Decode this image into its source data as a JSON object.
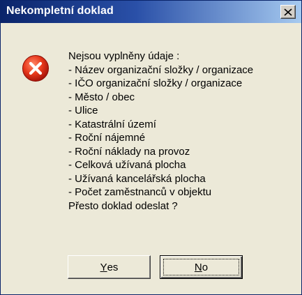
{
  "window": {
    "title": "Nekompletní doklad"
  },
  "icons": {
    "error": "error-icon",
    "close": "close-icon"
  },
  "message": {
    "intro": "Nejsou vyplněny údaje :",
    "items": [
      "- Název organizační složky / organizace",
      "- IČO organizační složky / organizace",
      "- Město / obec",
      "- Ulice",
      "- Katastrální území",
      "- Roční nájemné",
      "- Roční náklady na provoz",
      "- Celková užívaná plocha",
      "- Užívaná kancelářská plocha",
      "- Počet zaměstnanců v objektu"
    ],
    "question": "Přesto doklad odeslat ?"
  },
  "buttons": {
    "yes": {
      "mnemonic": "Y",
      "rest": "es"
    },
    "no": {
      "mnemonic": "N",
      "rest": "o"
    }
  },
  "colors": {
    "title_gradient_start": "#0a246a",
    "title_gradient_end": "#a6caf0",
    "error_red": "#d93c20"
  }
}
